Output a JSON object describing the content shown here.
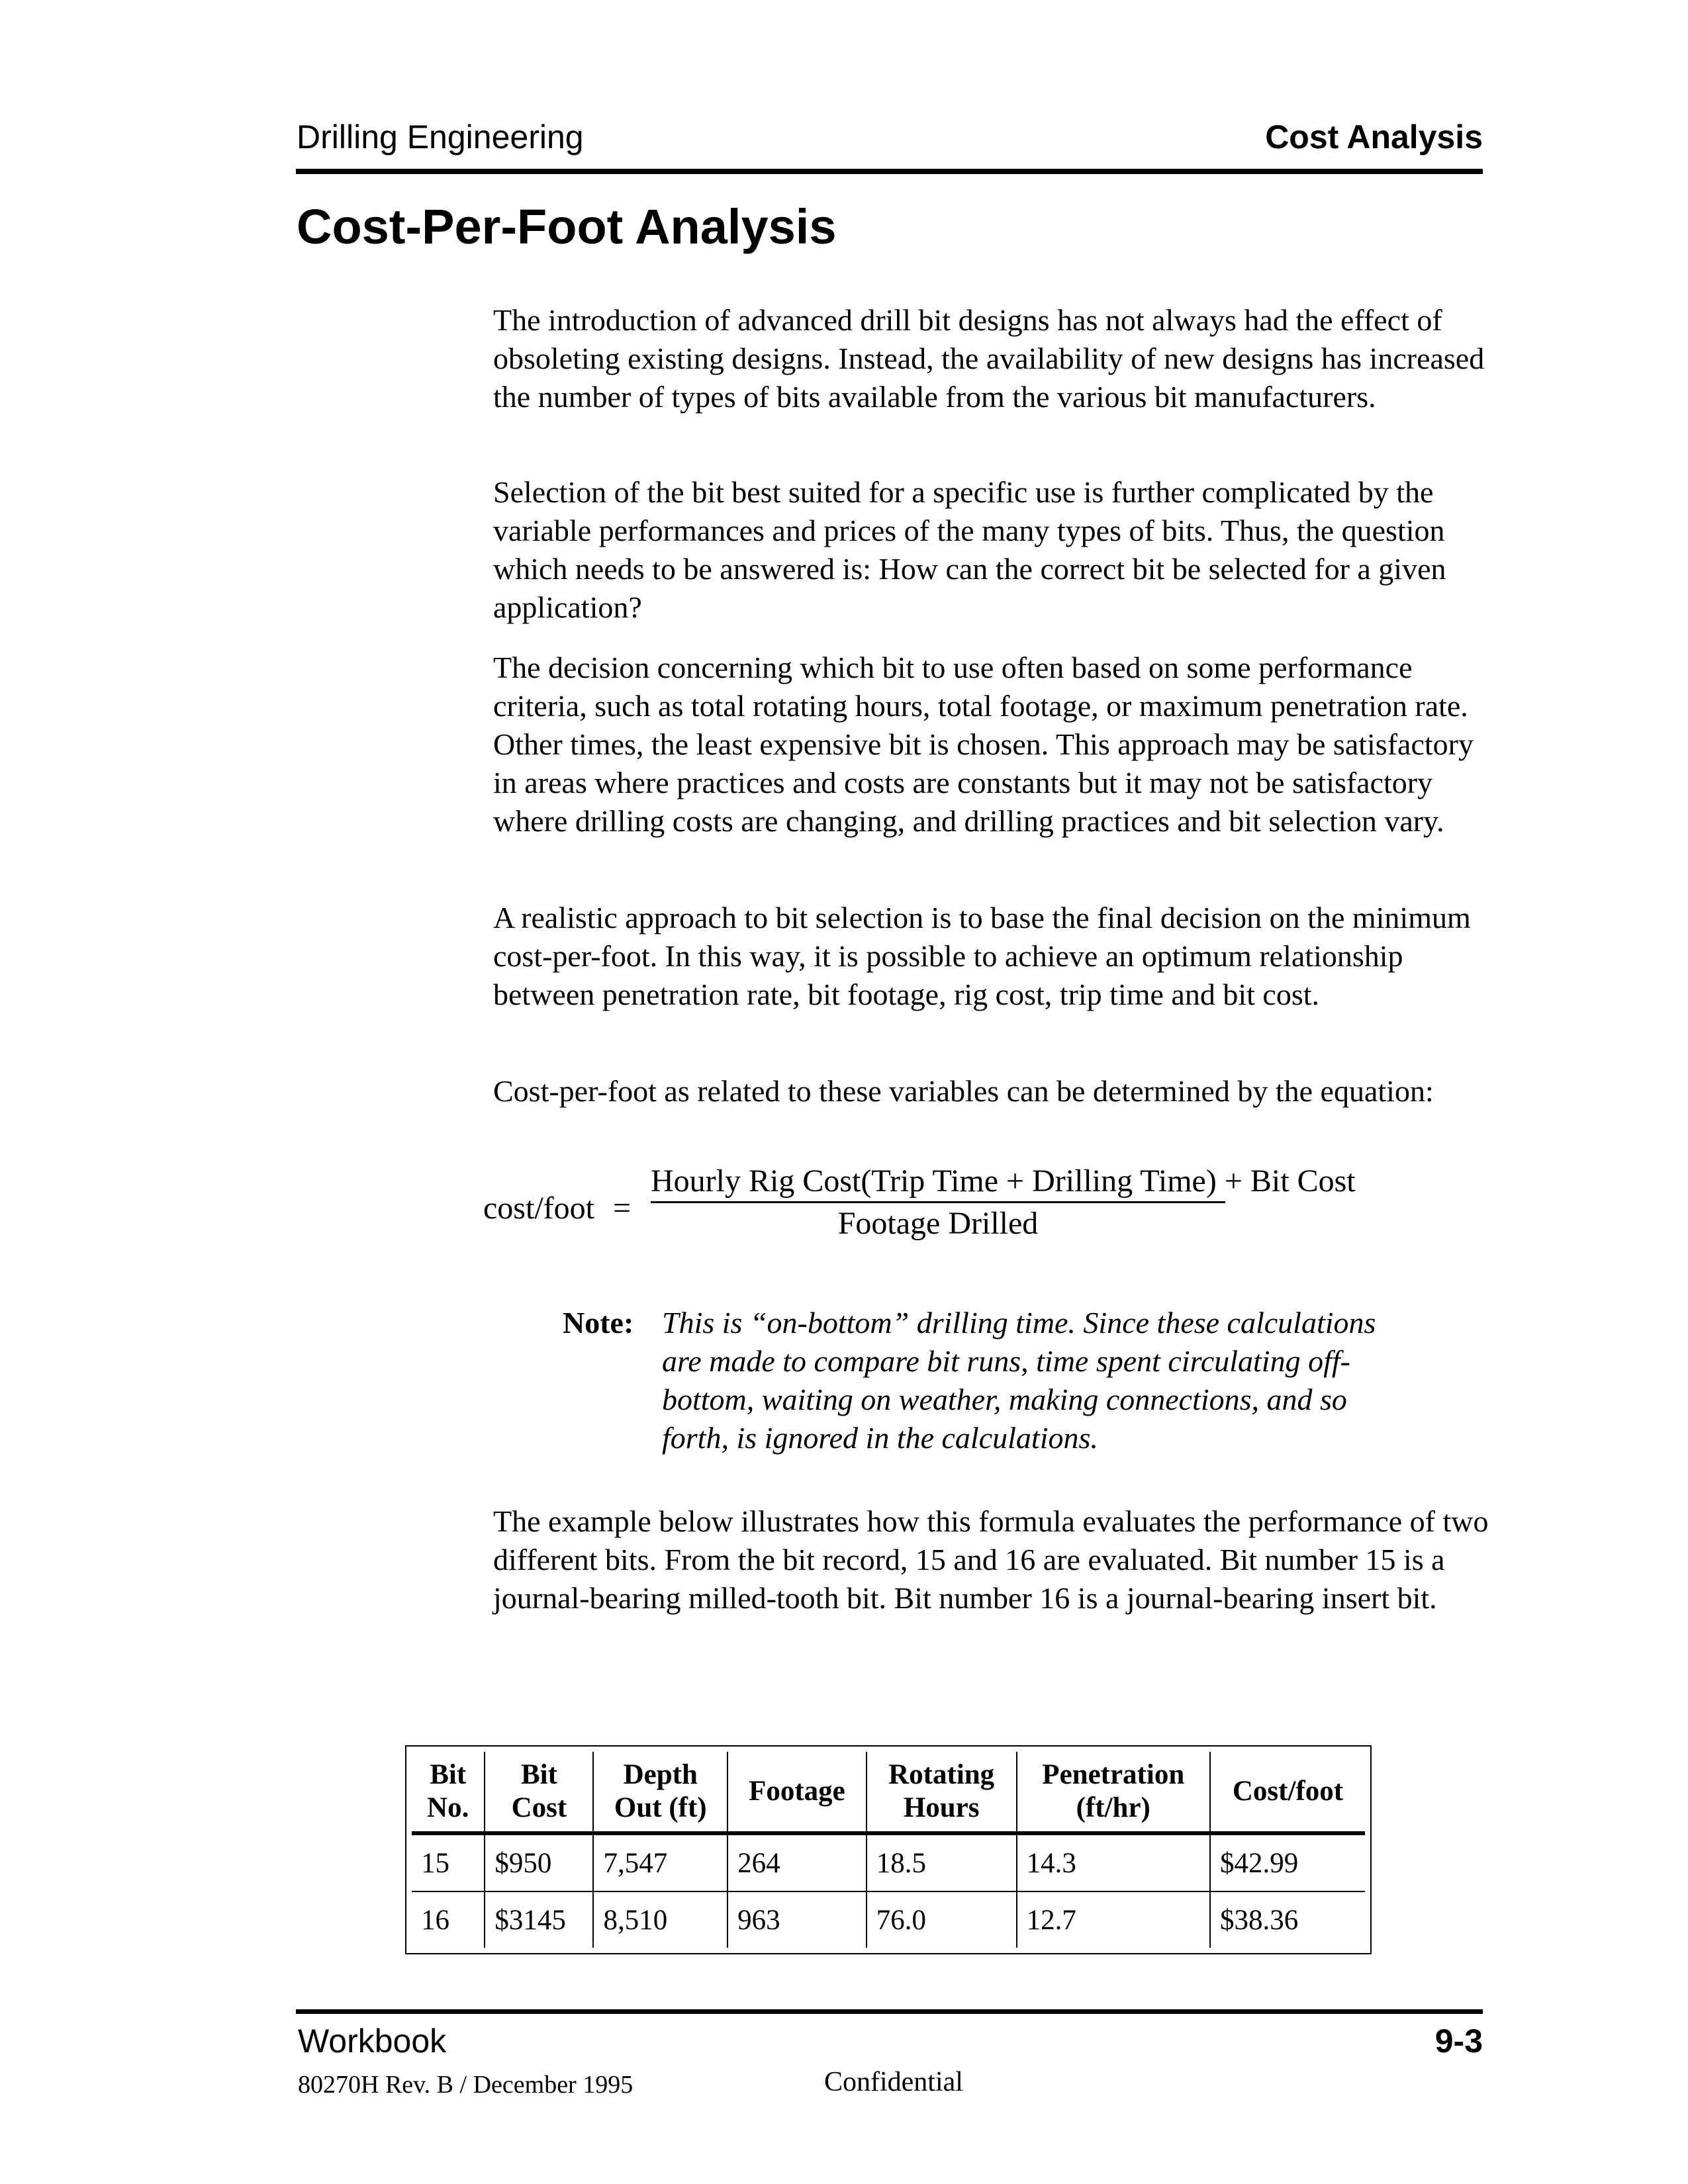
{
  "header": {
    "section": "Drilling Engineering",
    "chapter": "Cost Analysis"
  },
  "page_title": "Cost-Per-Foot Analysis",
  "paragraphs": [
    "The introduction of advanced drill bit designs has not always had the effect of obsoleting existing designs. Instead, the availability of new designs has increased the number of types of bits available from the various bit manufacturers.",
    "Selection of the bit best suited for a specific use is further complicated by the variable performances and prices of the many types of bits. Thus, the question which needs to be answered is: How can the correct bit be selected for a given application?",
    "The decision concerning which bit to use often based on some performance criteria, such as total rotating hours, total footage, or maximum penetration rate. Other times, the least expensive bit is chosen. This approach may be satisfactory in areas where practices and costs are constants but it may not be satisfactory where drilling costs are changing, and drilling practices and bit selection vary.",
    "A realistic approach to bit selection is to base the final decision on the minimum cost-per-foot. In this way, it is possible to achieve an optimum relationship between penetration rate, bit footage, rig cost, trip time and bit cost.",
    "Cost-per-foot as related to these variables can be determined by the equation:",
    "The example below illustrates how this formula evaluates the performance of two different bits. From the bit record, 15 and 16 are evaluated. Bit number 15 is a journal-bearing milled-tooth bit. Bit number 16 is a journal-bearing insert bit."
  ],
  "equation": {
    "lhs": "cost/foot",
    "equals": "=",
    "numerator": "Hourly Rig Cost(Trip Time + Drilling Time) + Bit Cost",
    "denominator": "Footage Drilled"
  },
  "note": {
    "label": "Note:",
    "text": "This is “on-bottom” drilling time. Since these calculations are made to compare bit runs, time spent circulating off-bottom, waiting on weather, making connections, and so forth, is ignored in the calculations."
  },
  "table": {
    "headers": [
      "Bit\nNo.",
      "Bit\nCost",
      "Depth\nOut (ft)",
      "Footage",
      "Rotating\nHours",
      "Penetration\n(ft/hr)",
      "Cost/foot"
    ],
    "rows": [
      [
        "15",
        "$950",
        "7,547",
        "264",
        "18.5",
        "14.3",
        "$42.99"
      ],
      [
        "16",
        "$3145",
        "8,510",
        "963",
        "76.0",
        "12.7",
        "$38.36"
      ]
    ]
  },
  "footer": {
    "left": "Workbook",
    "page_number": "9-3",
    "revision": "80270H Rev. B / December 1995",
    "classification": "Confidential"
  }
}
